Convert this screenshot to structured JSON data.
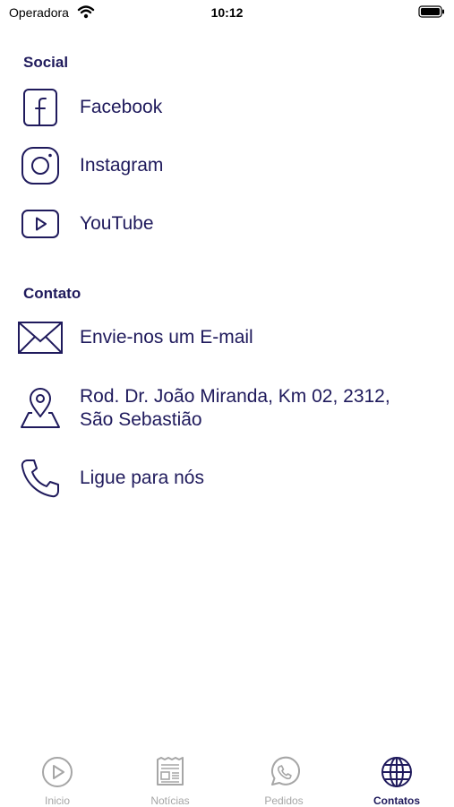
{
  "status_bar": {
    "carrier": "Operadora",
    "time": "10:12"
  },
  "social": {
    "title": "Social",
    "items": [
      {
        "label": "Facebook",
        "icon": "facebook-icon"
      },
      {
        "label": "Instagram",
        "icon": "instagram-icon"
      },
      {
        "label": "YouTube",
        "icon": "youtube-icon"
      }
    ]
  },
  "contato": {
    "title": "Contato",
    "items": [
      {
        "label": "Envie-nos um E-mail",
        "icon": "envelope-icon"
      },
      {
        "label_line1": "Rod. Dr. João Miranda, Km 02, 2312,",
        "label_line2": "São Sebastião",
        "icon": "map-pin-icon"
      },
      {
        "label": "Ligue para nós",
        "icon": "phone-icon"
      }
    ]
  },
  "tabs": [
    {
      "label": "Inicio",
      "icon": "play-icon",
      "active": false
    },
    {
      "label": "Notícias",
      "icon": "newspaper-icon",
      "active": false
    },
    {
      "label": "Pedidos",
      "icon": "whatsapp-icon",
      "active": false
    },
    {
      "label": "Contatos",
      "icon": "globe-icon",
      "active": true
    }
  ],
  "colors": {
    "accent": "#1f1a5c",
    "inactive": "#a6a6a6",
    "background": "#ffffff"
  }
}
